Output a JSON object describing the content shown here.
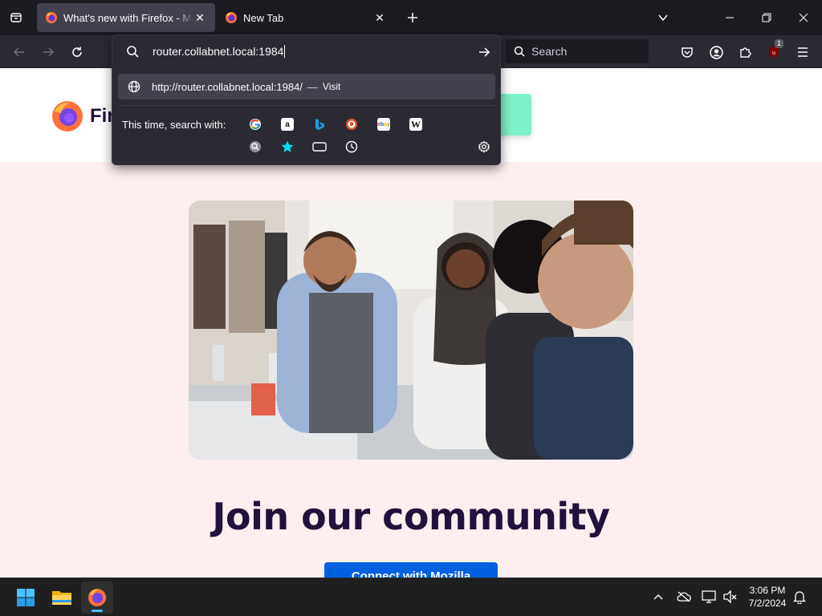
{
  "tabs": [
    {
      "title": "What's new with Firefox - More",
      "active": true
    },
    {
      "title": "New Tab",
      "active": false
    }
  ],
  "urlbar": {
    "value": "router.collabnet.local:1984",
    "result_url": "http://router.collabnet.local:1984/",
    "result_separator": "—",
    "result_action": "Visit",
    "oneoff_label": "This time, search with:",
    "engines": [
      "google-icon",
      "amazon-icon",
      "bing-icon",
      "duckduckgo-icon",
      "ebay-icon",
      "wikipedia-icon",
      "search-engine-icon",
      "bookmarks-icon",
      "tabs-icon",
      "history-icon"
    ]
  },
  "searchbar": {
    "placeholder": "Search"
  },
  "toolbar": {
    "extension_badge": "1"
  },
  "page": {
    "brand_name": "Firef",
    "headline": "Join our community",
    "cta_label": "Connect with Mozilla"
  },
  "taskbar": {
    "time": "3:06 PM",
    "date": "7/2/2024"
  },
  "colors": {
    "accent": "#0060df",
    "page_bg": "#fdeeef",
    "headline": "#20123a",
    "green_button": "#7ef3c9",
    "taskbar_indicator": "#4cc2ff"
  }
}
